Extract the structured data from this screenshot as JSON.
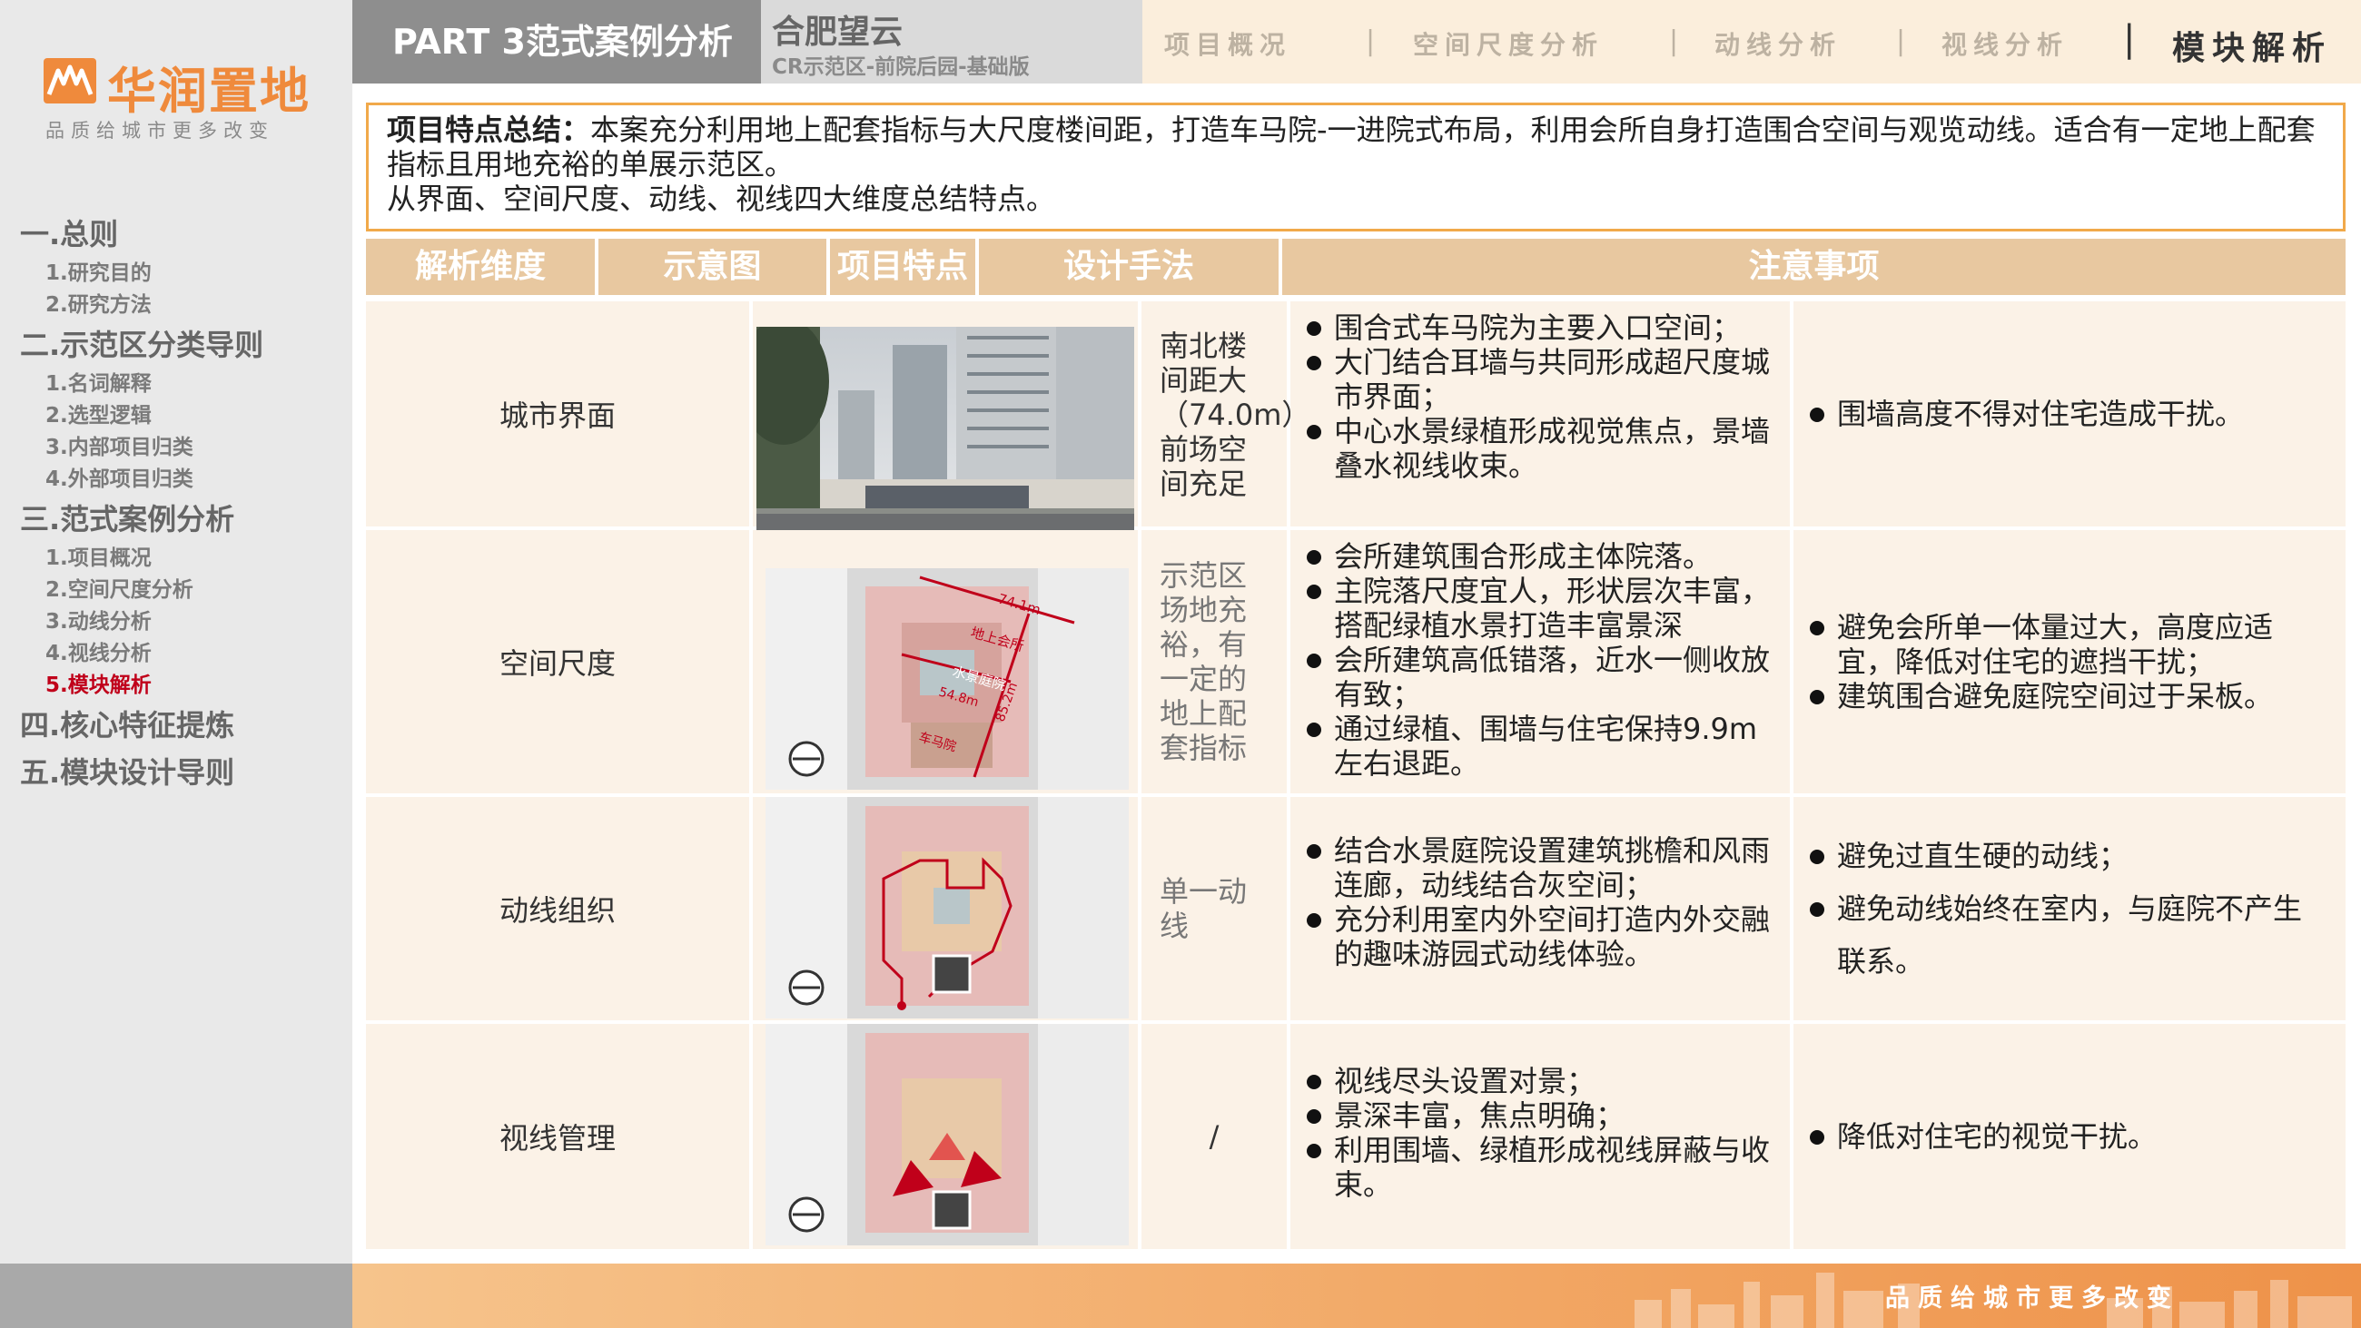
{
  "brand": {
    "name": "华润置地",
    "slogan": "品质给城市更多改变",
    "color": "#ef8a3c"
  },
  "sidebar": {
    "sections": [
      {
        "title": "一.总则",
        "items": [
          "1.研究目的",
          "2.研究方法"
        ]
      },
      {
        "title": "二.示范区分类导则",
        "items": [
          "1.名词解释",
          "2.选型逻辑",
          "3.内部项目归类",
          "4.外部项目归类"
        ]
      },
      {
        "title": "三.范式案例分析",
        "items": [
          "1.项目概况",
          "2.空间尺度分析",
          "3.动线分析",
          "4.视线分析",
          "5.模块解析"
        ]
      },
      {
        "title": "四.核心特征提炼",
        "items": []
      },
      {
        "title": "五.模块设计导则",
        "items": []
      }
    ],
    "active_item": "5.模块解析",
    "active_color": "#c0001a"
  },
  "header": {
    "part": "PART 3范式案例分析",
    "project_title": "合肥望云",
    "project_subtitle": "CR示范区-前院后园-基础版",
    "tabs": [
      "项目概况",
      "空间尺度分析",
      "动线分析",
      "视线分析",
      "模块解析"
    ],
    "active_tab": "模块解析",
    "separator": "|"
  },
  "summary": {
    "label": "项目特点总结：",
    "text": "本案充分利用地上配套指标与大尺度楼间距，打造车马院-一进院式布局，利用会所自身打造围合空间与观览动线。适合有一定地上配套指标且用地充裕的单展示范区。",
    "line2": "从界面、空间尺度、动线、视线四大维度总结特点。",
    "border_color": "#f1a94a"
  },
  "table": {
    "headers": [
      "解析维度",
      "示意图",
      "项目特点",
      "设计手法",
      "注意事项"
    ],
    "header_bg": "#e8c8a0",
    "cell_bg": "#fbf2e7",
    "rows": [
      {
        "dimension": "城市界面",
        "image": "street-photo",
        "feature": "南北楼间距大（74.0m），前场空间充足",
        "design": [
          "围合式车马院为主要入口空间；",
          "大门结合耳墙与共同形成超尺度城市界面；",
          "中心水景绿植形成视觉焦点，景墙叠水视线收束。"
        ],
        "notes": [
          "围墙高度不得对住宅造成干扰。"
        ]
      },
      {
        "dimension": "空间尺度",
        "image": "scale-diagram",
        "image_labels": [
          "74.1m",
          "地上会所",
          "水景庭院",
          "54.8m",
          "85.2m",
          "车马院"
        ],
        "feature": "示范区场地充裕，有一定的地上配套指标",
        "design": [
          "会所建筑围合形成主体院落。",
          "主院落尺度宜人，形状层次丰富，搭配绿植水景打造丰富景深",
          "会所建筑高低错落，近水一侧收放有致；",
          "通过绿植、围墙与住宅保持9.9m左右退距。"
        ],
        "notes": [
          "避免会所单一体量过大，高度应适宜，降低对住宅的遮挡干扰；",
          "建筑围合避免庭院空间过于呆板。"
        ]
      },
      {
        "dimension": "动线组织",
        "image": "circulation-diagram",
        "feature": "单一动线",
        "design": [
          "结合水景庭院设置建筑挑檐和风雨连廊，动线结合灰空间；",
          "充分利用室内外空间打造内外交融的趣味游园式动线体验。"
        ],
        "notes": [
          "避免过直生硬的动线；",
          "避免动线始终在室内，与庭院不产生联系。"
        ]
      },
      {
        "dimension": "视线管理",
        "image": "sightline-diagram",
        "feature": "/",
        "design": [
          "视线尽头设置对景；",
          "景深丰富，焦点明确；",
          "利用围墙、绿植形成视线屏蔽与收束。"
        ],
        "notes": [
          "降低对住宅的视觉干扰。"
        ]
      }
    ]
  },
  "footer": {
    "slogan": "品质给城市更多改变"
  }
}
